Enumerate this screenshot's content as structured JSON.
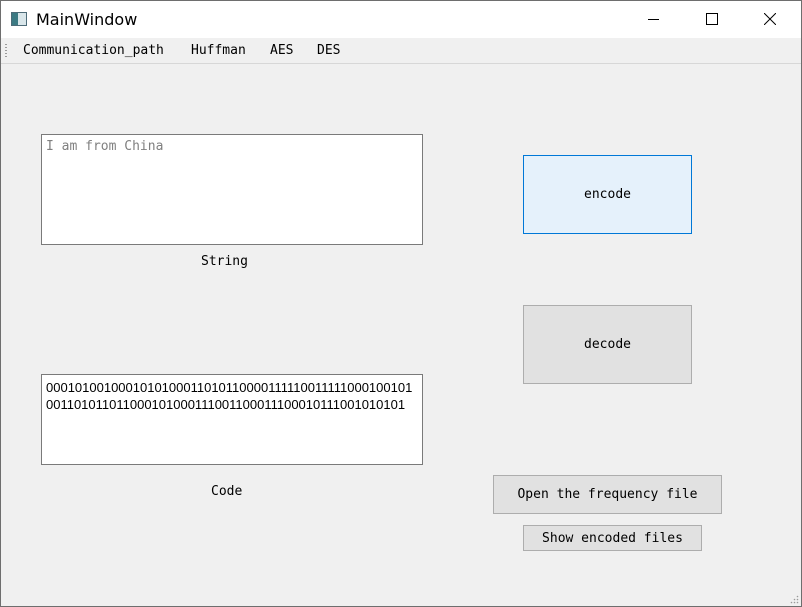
{
  "window": {
    "title": "MainWindow"
  },
  "menu": {
    "items": [
      "Communication_path",
      "Huffman",
      "AES",
      "DES"
    ]
  },
  "string_input": {
    "placeholder": "I am from China",
    "value": "",
    "label": "String"
  },
  "code_output": {
    "value": "0001010010001010100011010110000111110011111000100101001101011011000101000111001100011100010111001010101",
    "label": "Code"
  },
  "buttons": {
    "encode": "encode",
    "decode": "decode",
    "open_frequency": "Open the frequency file",
    "show_encoded": "Show encoded files"
  },
  "colors": {
    "focused_border": "#0078d7",
    "focused_bg": "#e5f1fb",
    "button_bg": "#e1e1e1"
  }
}
